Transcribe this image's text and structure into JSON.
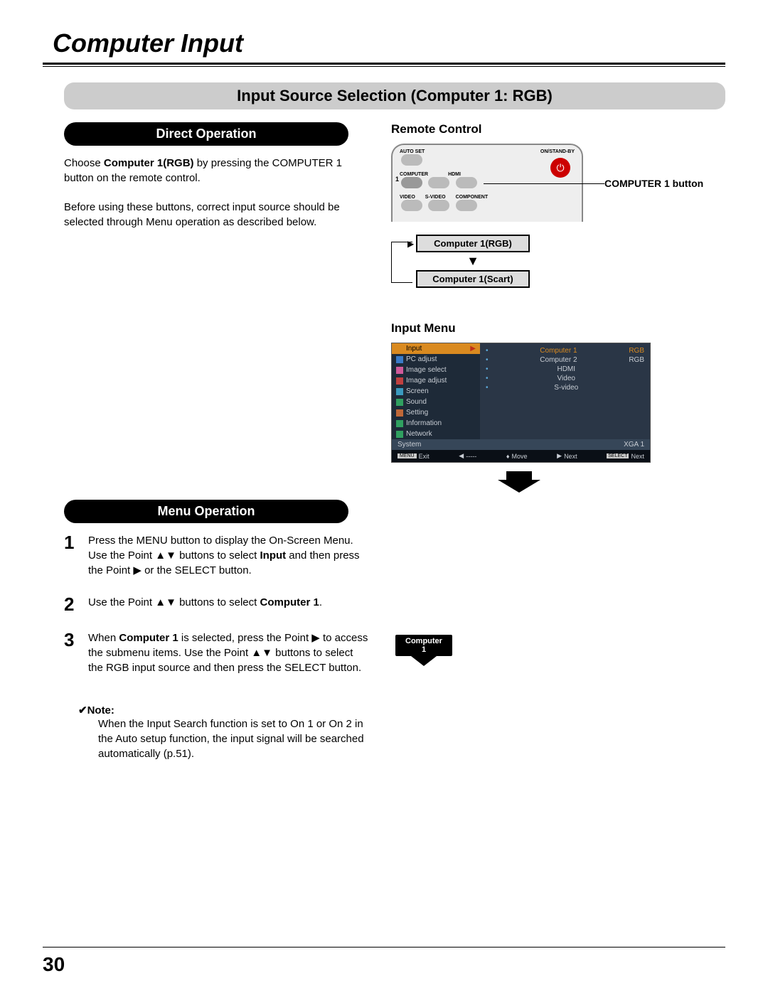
{
  "page": {
    "title": "Computer Input",
    "number": "30"
  },
  "section": {
    "header": "Input Source Selection (Computer 1: RGB)"
  },
  "direct": {
    "header": "Direct Operation",
    "para1_pre": "Choose ",
    "para1_bold": "Computer 1(RGB)",
    "para1_post": " by pressing the COMPUTER 1 button on the remote control.",
    "para2": "Before using these buttons, correct input source should be selected through Menu operation as described below."
  },
  "remote": {
    "heading": "Remote Control",
    "labels": {
      "autoset": "AUTO SET",
      "onstandby": "ON/STAND-BY",
      "computer": "COMPUTER",
      "hdmi": "HDMI",
      "video": "VIDEO",
      "svideo": "S-VIDEO",
      "component": "COMPONENT"
    },
    "callout": "COMPUTER 1 button",
    "flow1": "Computer 1(RGB)",
    "flow2": "Computer 1(Scart)"
  },
  "inputmenu": {
    "heading": "Input Menu"
  },
  "osd": {
    "left": [
      {
        "label": "Input",
        "color": "#d98a20",
        "active": true
      },
      {
        "label": "PC adjust",
        "color": "#3a7bc8"
      },
      {
        "label": "Image select",
        "color": "#d05a9a"
      },
      {
        "label": "Image adjust",
        "color": "#c04040"
      },
      {
        "label": "Screen",
        "color": "#3a9abf"
      },
      {
        "label": "Sound",
        "color": "#30a060"
      },
      {
        "label": "Setting",
        "color": "#c06838"
      },
      {
        "label": "Information",
        "color": "#30a060"
      },
      {
        "label": "Network",
        "color": "#30a060"
      }
    ],
    "right": [
      {
        "label": "Computer 1",
        "value": "RGB",
        "selected": true
      },
      {
        "label": "Computer 2",
        "value": "RGB"
      },
      {
        "label": "HDMI",
        "value": ""
      },
      {
        "label": "Video",
        "value": ""
      },
      {
        "label": "S-video",
        "value": ""
      }
    ],
    "system": {
      "label": "System",
      "value": "XGA 1"
    },
    "footer": {
      "exit": "Exit",
      "back": "-----",
      "move": "Move",
      "next1": "Next",
      "next2": "Next"
    }
  },
  "menu": {
    "header": "Menu Operation",
    "steps": [
      {
        "n": "1",
        "pre": "Press the MENU button to display the On-Screen Menu. Use the Point ▲▼ buttons to select ",
        "bold": "Input",
        "post": " and then press the Point ▶ or the SELECT button."
      },
      {
        "n": "2",
        "pre": "Use the Point ▲▼ buttons to select ",
        "bold": "Computer 1",
        "post": "."
      },
      {
        "n": "3",
        "pre": "When ",
        "bold": "Computer 1",
        "post": " is selected, press the Point ▶ to access the submenu items. Use the Point ▲▼ buttons to select the RGB input source and then press the SELECT button."
      }
    ]
  },
  "tooltip": {
    "line1": "Computer",
    "line2": "1"
  },
  "note": {
    "title": "✔Note:",
    "text": "When the Input Search function is set to On 1 or On 2 in the Auto setup function, the input signal will be searched automatically (p.51)."
  }
}
